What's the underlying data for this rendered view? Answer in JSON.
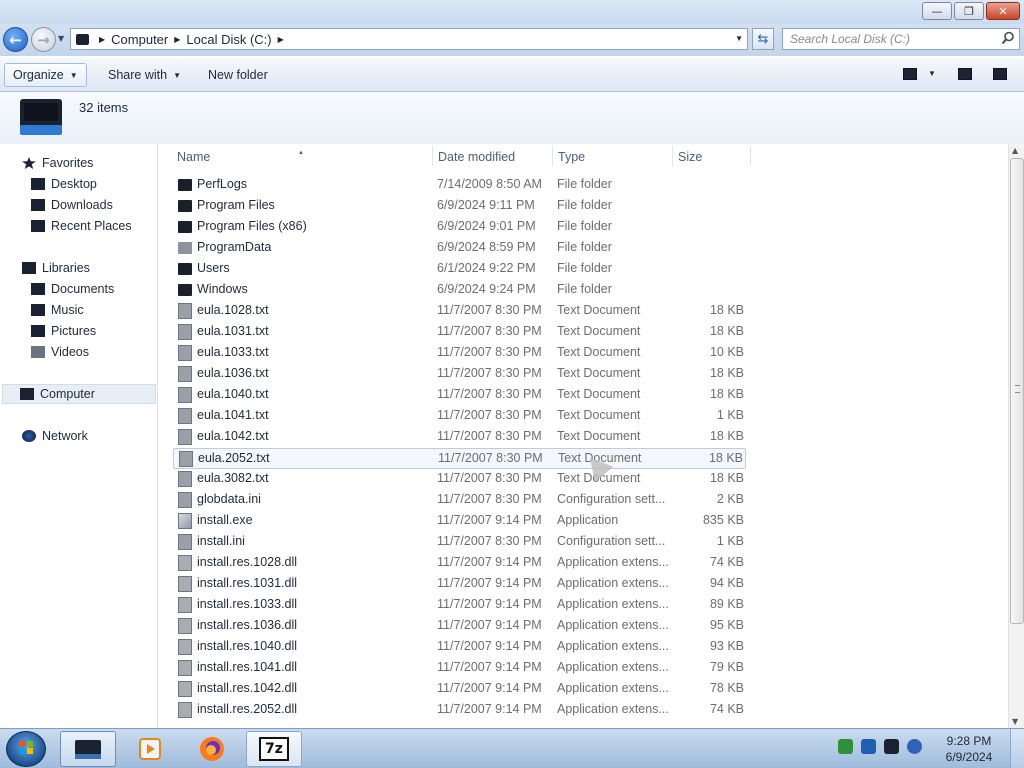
{
  "window": {
    "minimize_glyph": "—",
    "maximize_glyph": "❐",
    "close_glyph": "✕"
  },
  "address": {
    "crumbs": [
      "Computer",
      "Local Disk (C:)"
    ],
    "search_placeholder": "Search Local Disk (C:)"
  },
  "toolbar": {
    "organize": "Organize",
    "share_with": "Share with",
    "new_folder": "New folder"
  },
  "details": {
    "item_count": "32 items"
  },
  "nav": {
    "favorites": "Favorites",
    "desktop": "Desktop",
    "downloads": "Downloads",
    "recent_places": "Recent Places",
    "libraries": "Libraries",
    "documents": "Documents",
    "music": "Music",
    "pictures": "Pictures",
    "videos": "Videos",
    "computer": "Computer",
    "network": "Network"
  },
  "columns": {
    "name": "Name",
    "date": "Date modified",
    "type": "Type",
    "size": "Size"
  },
  "files": [
    {
      "name": "PerfLogs",
      "date": "7/14/2009 8:50 AM",
      "type": "File folder",
      "size": "",
      "icon": "folder-icon"
    },
    {
      "name": "Program Files",
      "date": "6/9/2024 9:11 PM",
      "type": "File folder",
      "size": "",
      "icon": "folder-icon"
    },
    {
      "name": "Program Files (x86)",
      "date": "6/9/2024 9:01 PM",
      "type": "File folder",
      "size": "",
      "icon": "folder-icon"
    },
    {
      "name": "ProgramData",
      "date": "6/9/2024 8:59 PM",
      "type": "File folder",
      "size": "",
      "icon": "hidden-folder-icon"
    },
    {
      "name": "Users",
      "date": "6/1/2024 9:22 PM",
      "type": "File folder",
      "size": "",
      "icon": "folder-icon"
    },
    {
      "name": "Windows",
      "date": "6/9/2024 9:24 PM",
      "type": "File folder",
      "size": "",
      "icon": "folder-icon"
    },
    {
      "name": "eula.1028.txt",
      "date": "11/7/2007 8:30 PM",
      "type": "Text Document",
      "size": "18 KB",
      "icon": "text-file-icon"
    },
    {
      "name": "eula.1031.txt",
      "date": "11/7/2007 8:30 PM",
      "type": "Text Document",
      "size": "18 KB",
      "icon": "text-file-icon"
    },
    {
      "name": "eula.1033.txt",
      "date": "11/7/2007 8:30 PM",
      "type": "Text Document",
      "size": "10 KB",
      "icon": "text-file-icon"
    },
    {
      "name": "eula.1036.txt",
      "date": "11/7/2007 8:30 PM",
      "type": "Text Document",
      "size": "18 KB",
      "icon": "text-file-icon"
    },
    {
      "name": "eula.1040.txt",
      "date": "11/7/2007 8:30 PM",
      "type": "Text Document",
      "size": "18 KB",
      "icon": "text-file-icon"
    },
    {
      "name": "eula.1041.txt",
      "date": "11/7/2007 8:30 PM",
      "type": "Text Document",
      "size": "1 KB",
      "icon": "text-file-icon"
    },
    {
      "name": "eula.1042.txt",
      "date": "11/7/2007 8:30 PM",
      "type": "Text Document",
      "size": "18 KB",
      "icon": "text-file-icon"
    },
    {
      "name": "eula.2052.txt",
      "date": "11/7/2007 8:30 PM",
      "type": "Text Document",
      "size": "18 KB",
      "icon": "text-file-icon",
      "selected": true
    },
    {
      "name": "eula.3082.txt",
      "date": "11/7/2007 8:30 PM",
      "type": "Text Document",
      "size": "18 KB",
      "icon": "text-file-icon"
    },
    {
      "name": "globdata.ini",
      "date": "11/7/2007 8:30 PM",
      "type": "Configuration sett...",
      "size": "2 KB",
      "icon": "config-file-icon"
    },
    {
      "name": "install.exe",
      "date": "11/7/2007 9:14 PM",
      "type": "Application",
      "size": "835 KB",
      "icon": "application-icon"
    },
    {
      "name": "install.ini",
      "date": "11/7/2007 8:30 PM",
      "type": "Configuration sett...",
      "size": "1 KB",
      "icon": "config-file-icon"
    },
    {
      "name": "install.res.1028.dll",
      "date": "11/7/2007 9:14 PM",
      "type": "Application extens...",
      "size": "74 KB",
      "icon": "dll-file-icon"
    },
    {
      "name": "install.res.1031.dll",
      "date": "11/7/2007 9:14 PM",
      "type": "Application extens...",
      "size": "94 KB",
      "icon": "dll-file-icon"
    },
    {
      "name": "install.res.1033.dll",
      "date": "11/7/2007 9:14 PM",
      "type": "Application extens...",
      "size": "89 KB",
      "icon": "dll-file-icon"
    },
    {
      "name": "install.res.1036.dll",
      "date": "11/7/2007 9:14 PM",
      "type": "Application extens...",
      "size": "95 KB",
      "icon": "dll-file-icon"
    },
    {
      "name": "install.res.1040.dll",
      "date": "11/7/2007 9:14 PM",
      "type": "Application extens...",
      "size": "93 KB",
      "icon": "dll-file-icon"
    },
    {
      "name": "install.res.1041.dll",
      "date": "11/7/2007 9:14 PM",
      "type": "Application extens...",
      "size": "79 KB",
      "icon": "dll-file-icon"
    },
    {
      "name": "install.res.1042.dll",
      "date": "11/7/2007 9:14 PM",
      "type": "Application extens...",
      "size": "78 KB",
      "icon": "dll-file-icon"
    },
    {
      "name": "install.res.2052.dll",
      "date": "11/7/2007 9:14 PM",
      "type": "Application extens...",
      "size": "74 KB",
      "icon": "dll-file-icon"
    }
  ],
  "taskbar": {
    "apps": [
      "windows-explorer-icon",
      "media-player-icon",
      "firefox-icon",
      "7zip-icon"
    ],
    "sevenzip_label": "7z",
    "time": "9:28 PM",
    "date": "6/9/2024"
  },
  "colors": {
    "accent": "#1f5fc0",
    "selection_border": "#b9cde7",
    "secondary_text": "#6d6d6d"
  }
}
